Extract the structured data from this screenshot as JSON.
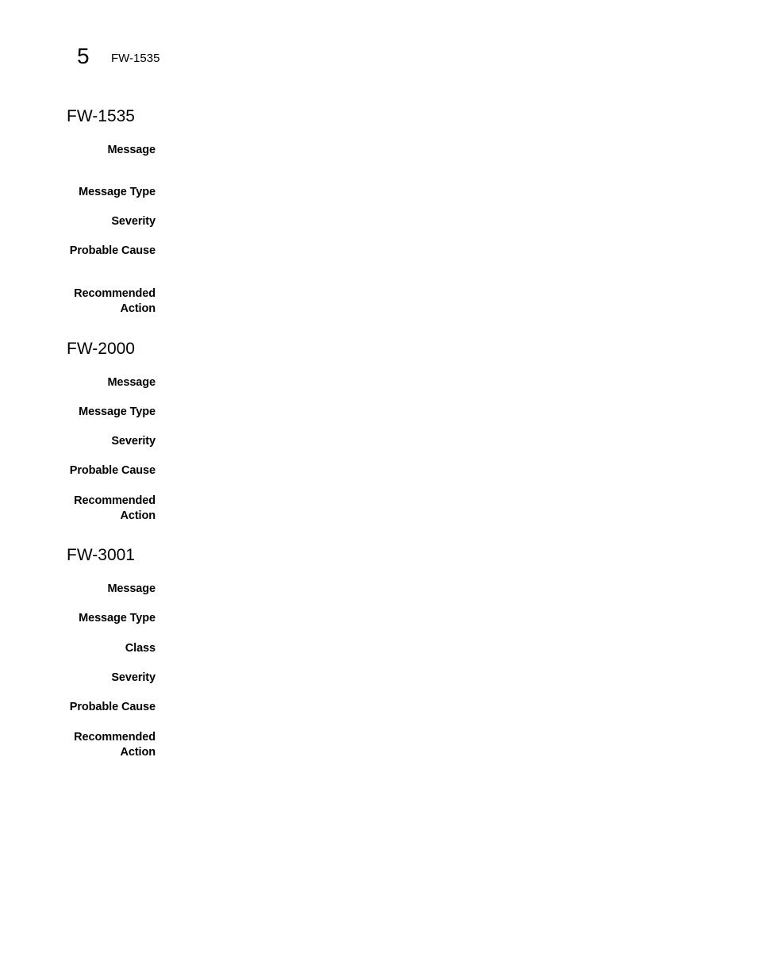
{
  "header": {
    "chapter_number": "5",
    "running_title": "FW-1535"
  },
  "sections": [
    {
      "title": "FW-1535",
      "fields": [
        {
          "label": "Message",
          "value": ""
        },
        {
          "label": "Message Type",
          "value": ""
        },
        {
          "label": "Severity",
          "value": ""
        },
        {
          "label": "Probable Cause",
          "value": ""
        },
        {
          "label": "Recommended Action",
          "value": ""
        }
      ]
    },
    {
      "title": "FW-2000",
      "fields": [
        {
          "label": "Message",
          "value": ""
        },
        {
          "label": "Message Type",
          "value": ""
        },
        {
          "label": "Severity",
          "value": ""
        },
        {
          "label": "Probable Cause",
          "value": ""
        },
        {
          "label": "Recommended Action",
          "value": ""
        }
      ]
    },
    {
      "title": "FW-3001",
      "fields": [
        {
          "label": "Message",
          "value": ""
        },
        {
          "label": "Message Type",
          "value": ""
        },
        {
          "label": "Class",
          "value": ""
        },
        {
          "label": "Severity",
          "value": ""
        },
        {
          "label": "Probable Cause",
          "value": ""
        },
        {
          "label": "Recommended Action",
          "value": ""
        }
      ]
    }
  ]
}
